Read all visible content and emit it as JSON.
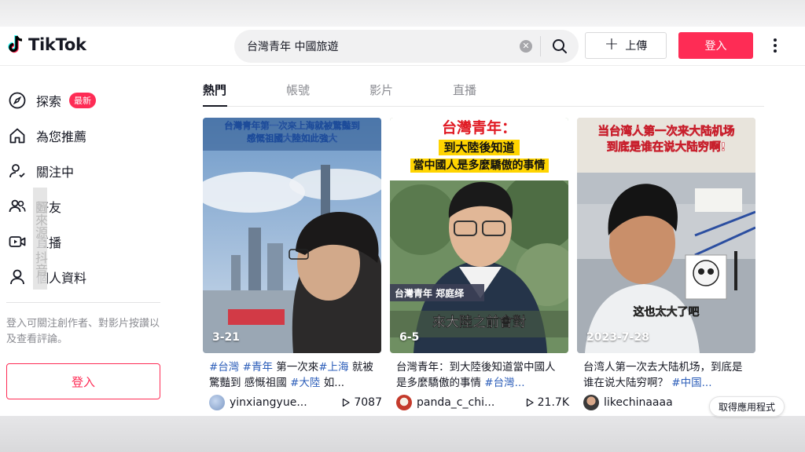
{
  "header": {
    "logo_text": "TikTok",
    "search_value": "台灣青年 中國旅遊",
    "upload_label": "上傳",
    "login_label": "登入"
  },
  "sidebar": {
    "items": [
      {
        "label": "探索",
        "icon": "compass-icon",
        "badge": "最新"
      },
      {
        "label": "為您推薦",
        "icon": "home-icon"
      },
      {
        "label": "關注中",
        "icon": "following-icon"
      },
      {
        "label": "好友",
        "icon": "friends-icon"
      },
      {
        "label": "直播",
        "icon": "live-icon"
      },
      {
        "label": "個人資料",
        "icon": "profile-icon"
      }
    ],
    "hint": "登入可關注創作者、對影片按讚以及查看評論。",
    "login_label": "登入",
    "overlay_text": "圖來源：抖音"
  },
  "tabs": [
    "熱門",
    "帳號",
    "影片",
    "直播"
  ],
  "videos": [
    {
      "date": "3-21",
      "overlay_line1": "台灣青年第一次來上海就被驚豔到",
      "overlay_line2": "感慨祖國大陸如此強大",
      "caption_parts": [
        {
          "text": "#台灣",
          "tag": true
        },
        {
          "text": " ",
          "tag": false
        },
        {
          "text": "#青年",
          "tag": true
        },
        {
          "text": " 第一次來",
          "tag": false
        },
        {
          "text": "#上海",
          "tag": true
        },
        {
          "text": " 就被驚豔到 感慨祖國 ",
          "tag": false
        },
        {
          "text": "#大陸",
          "tag": true
        },
        {
          "text": " 如...",
          "tag": false
        }
      ],
      "username": "yinxiangyue...",
      "views": "7087"
    },
    {
      "date": "6-5",
      "overlay_title": "台灣青年：",
      "overlay_line1": "到大陸後知道",
      "overlay_line2": "當中國人是多麼驕傲的事情",
      "name_tag": "台灣青年 郑庭绎",
      "subtitle": "來大陸之前會對",
      "caption_parts": [
        {
          "text": "台灣青年：到大陸後知道當中國人是多麼驕傲的事情 ",
          "tag": false
        },
        {
          "text": "#台灣...",
          "tag": true
        }
      ],
      "username": "panda_c_chi...",
      "views": "21.7K"
    },
    {
      "date": "2023-7-28",
      "overlay_line1": "当台湾人第一次来大陆机场",
      "overlay_line2": "到底是谁在说大陆穷啊!",
      "subtitle": "这也太大了吧",
      "caption_parts": [
        {
          "text": "台湾人第一次去大陆机场，到底是谁在说大陆穷啊？ ",
          "tag": false
        },
        {
          "text": "#中国...",
          "tag": true
        }
      ],
      "username": "likechinaaaa",
      "views": ""
    }
  ],
  "get_app_label": "取得應用程式",
  "colors": {
    "accent": "#fe2c55",
    "hashtag": "#2b5db9",
    "text": "#161823",
    "muted": "#8a8b91"
  }
}
